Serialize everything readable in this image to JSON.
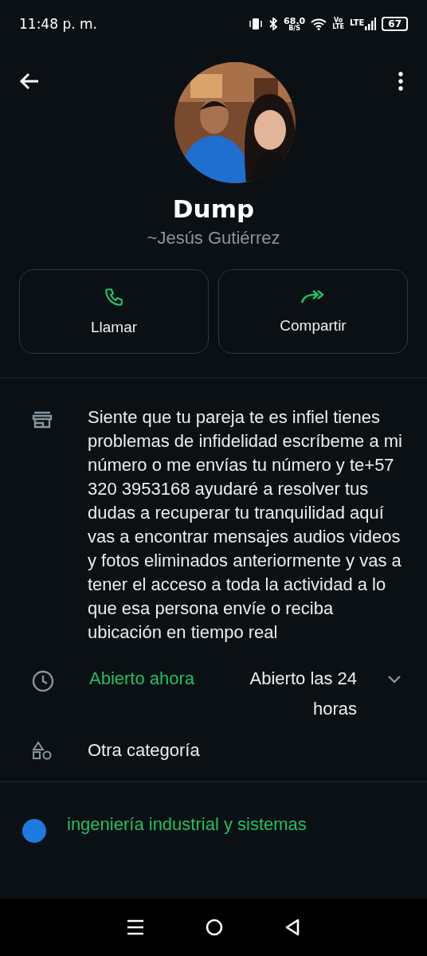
{
  "status_bar": {
    "time": "11:48 p. m.",
    "speed": "68.0",
    "speed_unit": "B/S",
    "volte_top": "Vo",
    "volte_bottom": "LTE",
    "network": "LTE",
    "battery": "67"
  },
  "profile": {
    "name": "Dump",
    "subtitle": "~Jesús Gutiérrez"
  },
  "actions": [
    {
      "label": "Llamar",
      "kind": "call"
    },
    {
      "label": "Compartir",
      "kind": "share"
    }
  ],
  "description": "Siente que tu pareja te es infiel tienes problemas de infidelidad escríbeme a mi número     o me envías tu número y te+57 320 3953168 ayudaré a resolver tus dudas a recuperar tu tranquilidad aquí vas a encontrar mensajes audios videos y fotos eliminados anteriormente y vas a tener el acceso a toda la actividad a lo que esa persona envíe o reciba ubicación en tiempo real",
  "hours": {
    "status": "Abierto ahora",
    "schedule": "Abierto las 24 horas",
    "expanded": false
  },
  "category": "Otra categoría",
  "link": "ingeniería industrial y sistemas"
}
